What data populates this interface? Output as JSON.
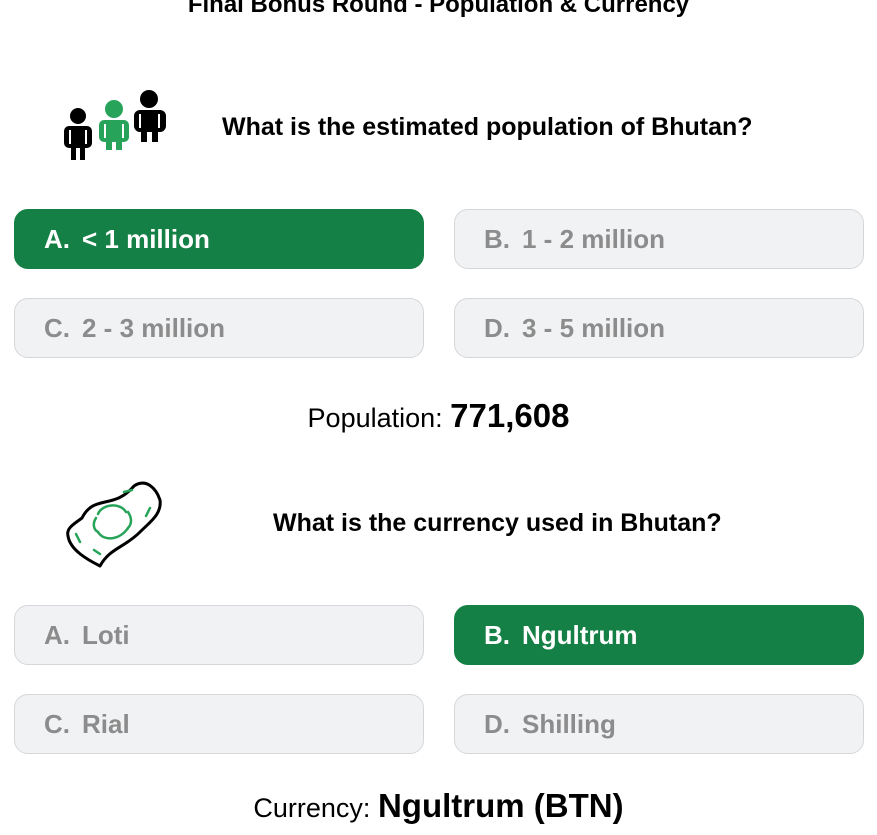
{
  "title": "Final Bonus Round - Population & Currency",
  "questions": [
    {
      "icon": "people-icon",
      "text": "What is the estimated population of Bhutan?",
      "options": [
        {
          "letter": "A.",
          "label": "< 1 million",
          "correct": true
        },
        {
          "letter": "B.",
          "label": "1 - 2 million",
          "correct": false
        },
        {
          "letter": "C.",
          "label": "2 - 3 million",
          "correct": false
        },
        {
          "letter": "D.",
          "label": "3 - 5 million",
          "correct": false
        }
      ],
      "answer_label": "Population: ",
      "answer_value": "771,608"
    },
    {
      "icon": "banknote-icon",
      "text": "What is the currency used in Bhutan?",
      "options": [
        {
          "letter": "A.",
          "label": "Loti",
          "correct": false
        },
        {
          "letter": "B.",
          "label": "Ngultrum",
          "correct": true
        },
        {
          "letter": "C.",
          "label": "Rial",
          "correct": false
        },
        {
          "letter": "D.",
          "label": "Shilling",
          "correct": false
        }
      ],
      "answer_label": "Currency: ",
      "answer_value": "Ngultrum (BTN)"
    }
  ],
  "colors": {
    "correct_bg": "#158045",
    "option_bg": "#f1f2f4",
    "option_text": "#8c8c8c",
    "icon_accent": "#27a35a"
  }
}
